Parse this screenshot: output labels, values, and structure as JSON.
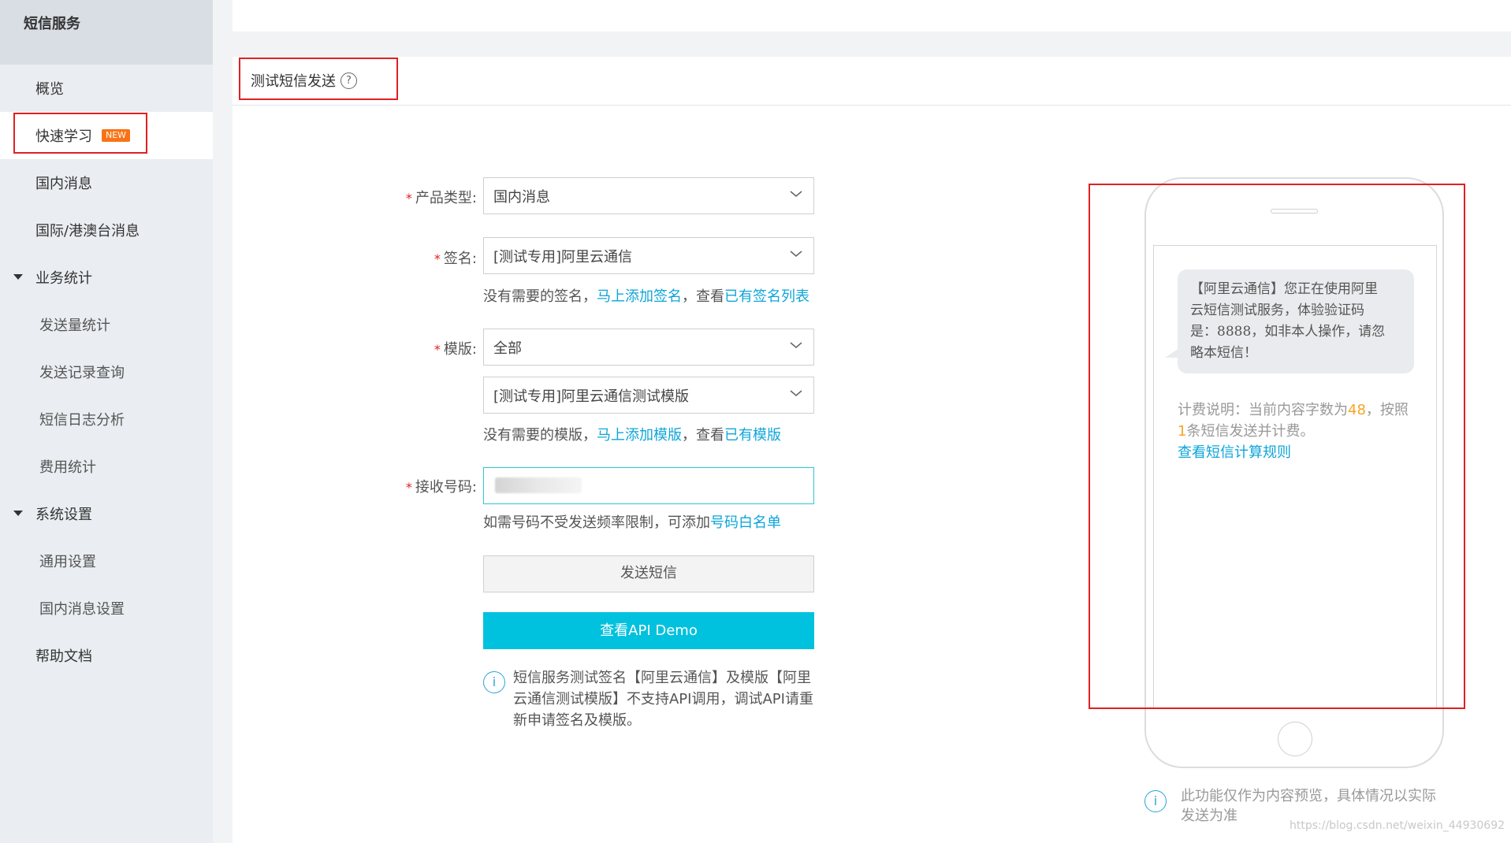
{
  "sidebar": {
    "title": "短信服务",
    "items": [
      {
        "label": "概览"
      },
      {
        "label": "快速学习",
        "badge": "NEW"
      },
      {
        "label": "国内消息"
      },
      {
        "label": "国际/港澳台消息"
      },
      {
        "label": "业务统计"
      },
      {
        "label": "发送量统计"
      },
      {
        "label": "发送记录查询"
      },
      {
        "label": "短信日志分析"
      },
      {
        "label": "费用统计"
      },
      {
        "label": "系统设置"
      },
      {
        "label": "通用设置"
      },
      {
        "label": "国内消息设置"
      },
      {
        "label": "帮助文档"
      }
    ]
  },
  "panel": {
    "title": "测试短信发送",
    "help_icon": "question-circle-icon"
  },
  "form": {
    "product_type": {
      "label": "产品类型:",
      "value": "国内消息"
    },
    "signature": {
      "label": "签名:",
      "value": "[测试专用]阿里云通信",
      "hint_prefix": "没有需要的签名，",
      "hint_link1": "马上添加签名",
      "hint_mid": "，查看",
      "hint_link2": "已有签名列表"
    },
    "template": {
      "label": "模版:",
      "value": "全部",
      "value2": "[测试专用]阿里云通信测试模版",
      "hint_prefix": "没有需要的模版，",
      "hint_link1": "马上添加模版",
      "hint_mid": "，查看",
      "hint_link2": "已有模版"
    },
    "phone": {
      "label": "接收号码:",
      "hint_prefix": "如需号码不受发送频率限制，可添加",
      "hint_link": "号码白名单"
    },
    "send_button": "发送短信",
    "api_button": "查看API Demo",
    "note_lines": [
      "短信服务测试签名【阿里云通信】及模版【阿里",
      "云通信测试模版】不支持API调用，调试API请重",
      "新申请签名及模版。"
    ]
  },
  "preview": {
    "message_lines": [
      "【阿里云通信】您正在使用阿里",
      "云短信测试服务，体验验证码",
      "是：8888，如非本人操作，请忽",
      "略本短信！"
    ],
    "billing_prefix": "计费说明：当前内容字数为",
    "char_count": "48",
    "billing_mid": "，按照",
    "sms_count": "1",
    "billing_suffix": "条短信发送并计费。",
    "billing_link": "查看短信计算规则",
    "footer_lines": [
      "此功能仅作为内容预览，具体情况以实际",
      "发送为准"
    ]
  },
  "watermark": "https://blog.csdn.net/weixin_44930692",
  "colors": {
    "accent": "#00c1de",
    "link": "#0ea5d9",
    "highlight": "#e02020",
    "badge": "#f97316"
  }
}
